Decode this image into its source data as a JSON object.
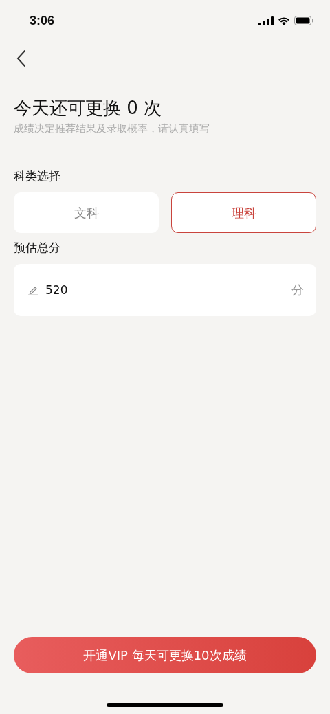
{
  "status_bar": {
    "time": "3:06"
  },
  "title": "今天还可更换 0 次",
  "subtitle": "成绩决定推荐结果及录取概率，请认真填写",
  "subject_section": {
    "label": "科类选择",
    "options": [
      {
        "label": "文科",
        "selected": false
      },
      {
        "label": "理科",
        "selected": true
      }
    ]
  },
  "score_section": {
    "label": "预估总分",
    "value": "520",
    "unit": "分"
  },
  "vip_button": "开通VIP 每天可更换10次成绩"
}
